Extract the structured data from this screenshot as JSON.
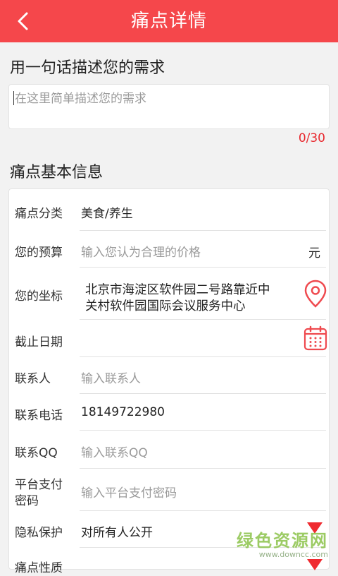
{
  "header": {
    "title": "痛点详情"
  },
  "demand": {
    "section_title": "用一句话描述您的需求",
    "placeholder": "在这里简单描述您的需求",
    "counter": "0/30"
  },
  "info": {
    "section_title": "痛点基本信息",
    "category": {
      "label": "痛点分类",
      "value": "美食/养生"
    },
    "budget": {
      "label": "您的预算",
      "placeholder": "输入您认为合理的价格",
      "unit": "元"
    },
    "location": {
      "label": "您的坐标",
      "line1": "北京市海淀区软件园二号路靠近中",
      "line2": "关村软件园国际会议服务中心"
    },
    "deadline": {
      "label": "截止日期"
    },
    "contact": {
      "label": "联系人",
      "placeholder": "输入联系人"
    },
    "phone": {
      "label": "联系电话",
      "value": "18149722980"
    },
    "qq": {
      "label": "联系QQ",
      "placeholder": "输入联系QQ"
    },
    "payment": {
      "label_line1": "平台支付",
      "label_line2": "密码",
      "placeholder": "输入平台支付密码"
    },
    "privacy": {
      "label": "隐私保护",
      "value": "对所有人公开"
    },
    "nature": {
      "label": "痛点性质"
    }
  },
  "colors": {
    "accent": "#f5474b",
    "counter": "#e8292f"
  },
  "watermark": {
    "main": "绿色资源网",
    "sub": "www.downcc.com"
  }
}
